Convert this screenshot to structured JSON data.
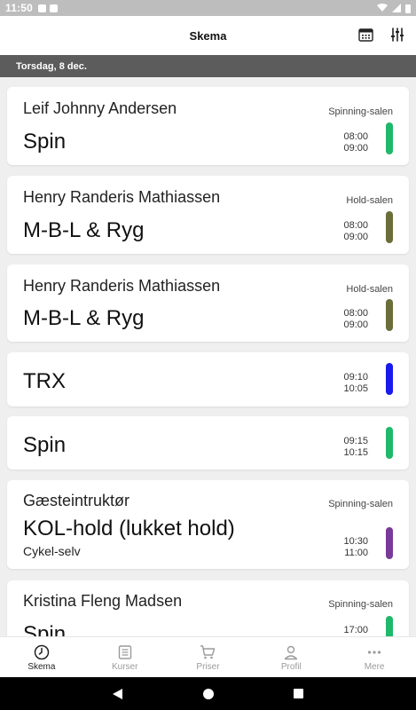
{
  "status": {
    "time": "11:50"
  },
  "header": {
    "title": "Skema"
  },
  "date_label": "Torsdag, 8 dec.",
  "classes": [
    {
      "instructor": "Leif Johnny Andersen",
      "room": "Spinning-salen",
      "name": "Spin",
      "start": "08:00",
      "end": "09:00",
      "color": "#20b86a"
    },
    {
      "instructor": "Henry Randeris Mathiassen",
      "room": "Hold-salen",
      "name": "M-B-L & Ryg",
      "start": "08:00",
      "end": "09:00",
      "color": "#6b6e3a"
    },
    {
      "instructor": "Henry Randeris Mathiassen",
      "room": "Hold-salen",
      "name": "M-B-L & Ryg",
      "start": "08:00",
      "end": "09:00",
      "color": "#6b6e3a"
    },
    {
      "name": "TRX",
      "start": "09:10",
      "end": "10:05",
      "color": "#1a1aee"
    },
    {
      "name": "Spin",
      "start": "09:15",
      "end": "10:15",
      "color": "#20b86a"
    },
    {
      "instructor": "Gæsteintruktør",
      "room": "Spinning-salen",
      "name": "KOL-hold (lukket hold)",
      "subtitle": "Cykel-selv",
      "start": "10:30",
      "end": "11:00",
      "color": "#7a3a9a"
    },
    {
      "instructor": "Kristina Fleng Madsen",
      "room": "Spinning-salen",
      "name": "Spin",
      "start": "17:00",
      "end": "",
      "color": "#20b86a"
    }
  ],
  "nav": [
    {
      "label": "Skema",
      "icon": "clock-icon"
    },
    {
      "label": "Kurser",
      "icon": "list-icon"
    },
    {
      "label": "Priser",
      "icon": "cart-icon"
    },
    {
      "label": "Profil",
      "icon": "person-icon"
    },
    {
      "label": "Mere",
      "icon": "more-icon"
    }
  ]
}
